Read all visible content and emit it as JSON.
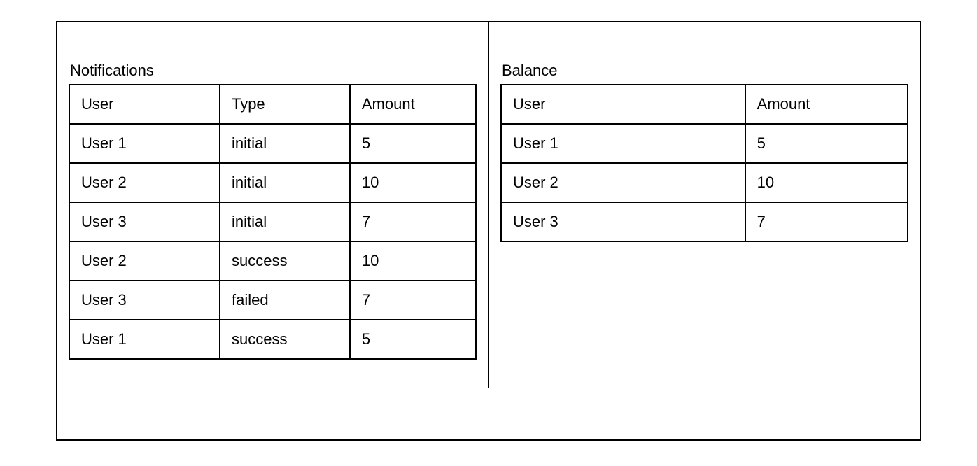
{
  "notifications": {
    "title": "Notifications",
    "headers": {
      "user": "User",
      "type": "Type",
      "amount": "Amount"
    },
    "rows": [
      {
        "user": "User 1",
        "type": "initial",
        "amount": "5"
      },
      {
        "user": "User 2",
        "type": "initial",
        "amount": "10"
      },
      {
        "user": "User 3",
        "type": "initial",
        "amount": "7"
      },
      {
        "user": "User 2",
        "type": "success",
        "amount": "10"
      },
      {
        "user": "User 3",
        "type": "failed",
        "amount": "7"
      },
      {
        "user": "User 1",
        "type": "success",
        "amount": "5"
      }
    ]
  },
  "balance": {
    "title": "Balance",
    "headers": {
      "user": "User",
      "amount": "Amount"
    },
    "rows": [
      {
        "user": "User 1",
        "amount": "5"
      },
      {
        "user": "User 2",
        "amount": "10"
      },
      {
        "user": "User 3",
        "amount": "7"
      }
    ]
  }
}
